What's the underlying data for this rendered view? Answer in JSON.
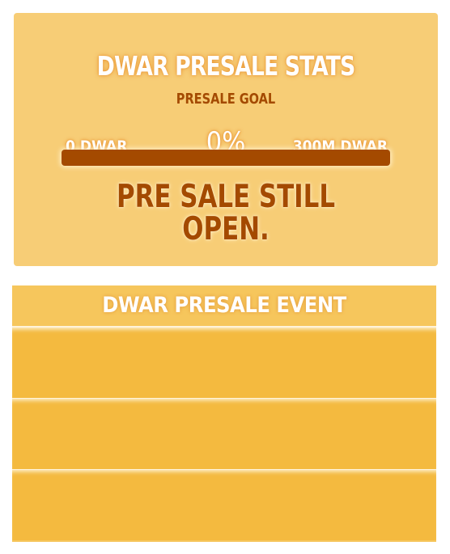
{
  "stats": {
    "title": "DWAR PRESALE STATS",
    "goal_label": "PRESALE GOAL",
    "min_label": "0 DWAR",
    "max_label": "300M DWAR",
    "percent_label": "0%",
    "progress_fraction": 0,
    "status_line1": "PRE SALE STILL",
    "status_line2": "OPEN."
  },
  "event": {
    "title": "DWAR PRESALE EVENT",
    "rows": [
      "",
      "",
      ""
    ]
  },
  "colors": {
    "card_bg": "#f7cd76",
    "accent_brown": "#a44a00",
    "event_bg": "#f4ba3f"
  }
}
